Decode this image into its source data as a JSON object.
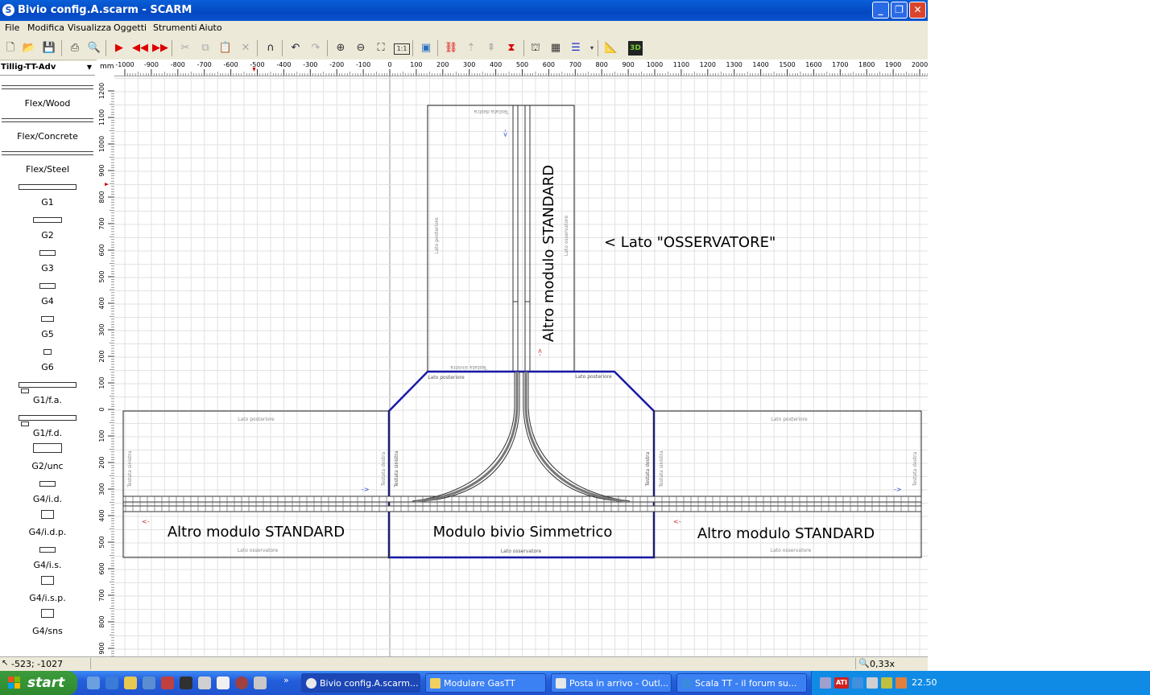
{
  "window": {
    "title": "Bivio config.A.scarm - SCARM",
    "app_icon": "scarm-icon",
    "controls": [
      "minimize",
      "maximize",
      "close"
    ]
  },
  "menu": [
    "File",
    "Modifica",
    "Visualizza",
    "Oggetti",
    "Strumenti",
    "Aiuto"
  ],
  "library": {
    "selected": "Tillig-TT-Adv",
    "items": [
      "Flex/Wood",
      "Flex/Concrete",
      "Flex/Steel",
      "G1",
      "G2",
      "G3",
      "G4",
      "G5",
      "G6",
      "G1/f.a.",
      "G1/f.d.",
      "G2/unc",
      "G4/i.d.",
      "G4/i.d.p.",
      "G4/i.s.",
      "G4/i.s.p.",
      "G4/sns"
    ]
  },
  "ruler": {
    "unit": "mm",
    "x_labels": [
      "-1000",
      "-900",
      "-800",
      "-700",
      "-600",
      "-500",
      "-400",
      "-300",
      "-200",
      "-100",
      "0",
      "100",
      "200",
      "300",
      "400",
      "500",
      "600",
      "700",
      "800",
      "900",
      "1000",
      "1100",
      "1200",
      "1300",
      "1400",
      "1500",
      "1600",
      "1700",
      "1800",
      "1900",
      "2000"
    ],
    "y_labels": [
      "1200",
      "1100",
      "1000",
      "900",
      "800",
      "700",
      "600",
      "500",
      "400",
      "300",
      "200",
      "100",
      "0",
      "100",
      "200",
      "300",
      "400",
      "500",
      "600",
      "700",
      "800",
      "900"
    ]
  },
  "layout": {
    "labels": {
      "vertical_module": "Altro modulo STANDARD",
      "observer": "< Lato \"OSSERVATORE\"",
      "left_module": "Altro modulo STANDARD",
      "center_module": "Modulo bivio Simmetrico",
      "right_module": "Altro modulo STANDARD"
    },
    "small": {
      "lato_posteriore": "Lato posteriore",
      "lato_osservatore": "Lato osservatore",
      "testata_sinistra": "Testata sinistra",
      "testata_destra": "Testata destra",
      "arrow_right": "->",
      "arrow_left": "<-"
    }
  },
  "status": {
    "coords": "-523; -1027",
    "zoom": "0,33x"
  },
  "taskbar": {
    "start": "start",
    "tasks": [
      "Bivio config.A.scarm...",
      "Modulare GasTT",
      "Posta in arrivo - Outl...",
      "Scala TT - il forum su..."
    ],
    "clock": "22.50"
  },
  "colors": {
    "titlebar": "#0a5fd8",
    "module_outline_blue": "#1a1aa8",
    "track": "#333333",
    "taskbar": "#245edb",
    "start": "#3c9b3c"
  }
}
